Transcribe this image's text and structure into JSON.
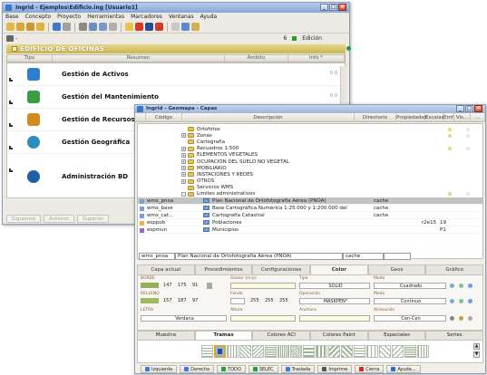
{
  "back_window": {
    "title": "Ingrid - Ejemplos\\Edificio.ing [Usuario1]",
    "menu": [
      "Base",
      "Concepto",
      "Proyecto",
      "Herramientas",
      "Marcadores",
      "Ventanas",
      "Ayuda"
    ],
    "toolbar2_left": "-",
    "toolbar2_count": "6",
    "toolbar2_mode": "Edición",
    "header": "EDIFICIO DE OFICINAS",
    "columns": [
      "Tipo",
      "Resumen",
      "Ámbito",
      "Info *"
    ],
    "modules": [
      {
        "label": "Gestión de Activos",
        "info": "0 0",
        "color": "#2f7dd1"
      },
      {
        "label": "Gestión del Mantenimiento",
        "info": "0 0",
        "color": "#3b9d42"
      },
      {
        "label": "Gestión de Recursos Hum",
        "info": "",
        "color": "#d58a1f"
      },
      {
        "label": "Gestión Geográfica",
        "info": "",
        "color": "#2a8fc4"
      },
      {
        "label": "Administración BD",
        "info": "",
        "color": "#1f5fa8"
      }
    ],
    "bottom_buttons": [
      "Siguiente",
      "Anterior",
      "Superior"
    ]
  },
  "front_window": {
    "title": "Ingrid - Geomapa - Capas",
    "columns": [
      "Código",
      "Descripción",
      "Directorio",
      "Propiedades",
      "Escalas",
      "Emf",
      "Vis...",
      "..."
    ],
    "tree": [
      {
        "indent": 1,
        "expander": "",
        "label": "Ortofotos"
      },
      {
        "indent": 2,
        "expander": "+",
        "label": "Zonas"
      },
      {
        "indent": 2,
        "expander": "",
        "label": "Cartografía"
      },
      {
        "indent": 2,
        "expander": "+",
        "label": "Recuadros 1:500"
      },
      {
        "indent": 2,
        "expander": "+",
        "label": "ELEMENTOS VEGETALES"
      },
      {
        "indent": 2,
        "expander": "+",
        "label": "OCUPACIÓN DEL SUELO NO VEGETAL"
      },
      {
        "indent": 2,
        "expander": "+",
        "label": "MOBILIARIO"
      },
      {
        "indent": 2,
        "expander": "+",
        "label": "INSTACIONES Y REDES"
      },
      {
        "indent": 2,
        "expander": "+",
        "label": "OTROS"
      },
      {
        "indent": 2,
        "expander": "",
        "label": "Servicios WMS"
      },
      {
        "indent": 2,
        "expander": "-",
        "label": "Limites administrativos"
      }
    ],
    "layers": [
      {
        "code": "wms_pnoa",
        "desc": "Plan Nacional de Ortofotografía Aérea (PNOA)",
        "dir": "cache",
        "esc": "",
        "emf": "",
        "selected": true,
        "sq": "#7e9fd0"
      },
      {
        "code": "wms_base",
        "desc": "Base Cartográfica Numérica 1:25.000 y 1:200.000 del",
        "dir": "cache",
        "esc": "",
        "emf": "",
        "selected": false,
        "sq": "#7e9fd0"
      },
      {
        "code": "wms_cat...",
        "desc": "Cartografía Catastral",
        "dir": "cache",
        "esc": "",
        "emf": "",
        "selected": false,
        "sq": "#7e9fd0"
      },
      {
        "code": "esppob",
        "desc": "Poblaciones",
        "dir": "",
        "esc": "r2e15",
        "emf": "19",
        "selected": false,
        "sq": "#e8b84a"
      },
      {
        "code": "espmun",
        "desc": "Municipios",
        "dir": "",
        "esc": "",
        "emf": "P1",
        "selected": false,
        "sq": "#9b6ac8"
      }
    ],
    "edit_row": {
      "code": "wms_pnoa",
      "desc": "Plan Nacional de Ortofotografía Aérea (PNOA)",
      "dir": "cache"
    },
    "tabs": [
      "Capa actual",
      "Procedimientos",
      "Configuraciones",
      "Color",
      "Geos",
      "Gráfico"
    ],
    "active_tab": "Color",
    "color_props": {
      "borde_label": "BORDE",
      "borde_rgb": [
        "147",
        "175",
        "91"
      ],
      "grosor_label": "Grosor (m-p)",
      "tipo_label": "Tipo",
      "tipo_value": "SOLID",
      "modo_label": "Modo",
      "modo_value": "Cuadrado",
      "relleno_label": "RELLENO",
      "relleno_rgb": [
        "157",
        "187",
        "97"
      ],
      "fondo_label": "Fondo",
      "fondo_rgb": [
        "255",
        "255",
        "255"
      ],
      "operacion_label": "Operación",
      "operacion_value": "MASKPEN*",
      "modo2_label": "Modo",
      "modo2_value": "Continuo",
      "letra_label": "LETRA",
      "letra_value": "Verdana",
      "altura_label": "Altura",
      "anchura_label": "Anchura",
      "alineacion_label": "Alineación",
      "alineacion_value": "Cen-Cen"
    },
    "pattern_tabs": [
      "Muestra",
      "Tramas",
      "Colores ACI",
      "Colores Paint",
      "Especiales",
      "Series"
    ],
    "active_pattern_tab": "Tramas",
    "bottom_buttons": [
      {
        "label": "Izquierda",
        "color": "#3a7bd5"
      },
      {
        "label": "Derecha",
        "color": "#3a7bd5"
      },
      {
        "label": "TODO",
        "color": "#2e9b3a"
      },
      {
        "label": "SELEC",
        "color": "#2e9b3a"
      },
      {
        "label": "Traslada",
        "color": "#3a7bd5"
      },
      {
        "label": "Imprime",
        "color": "#555555"
      },
      {
        "label": "Cierra",
        "color": "#d42c1e"
      },
      {
        "label": "Ayuda...",
        "color": "#2a6fc4"
      }
    ]
  }
}
